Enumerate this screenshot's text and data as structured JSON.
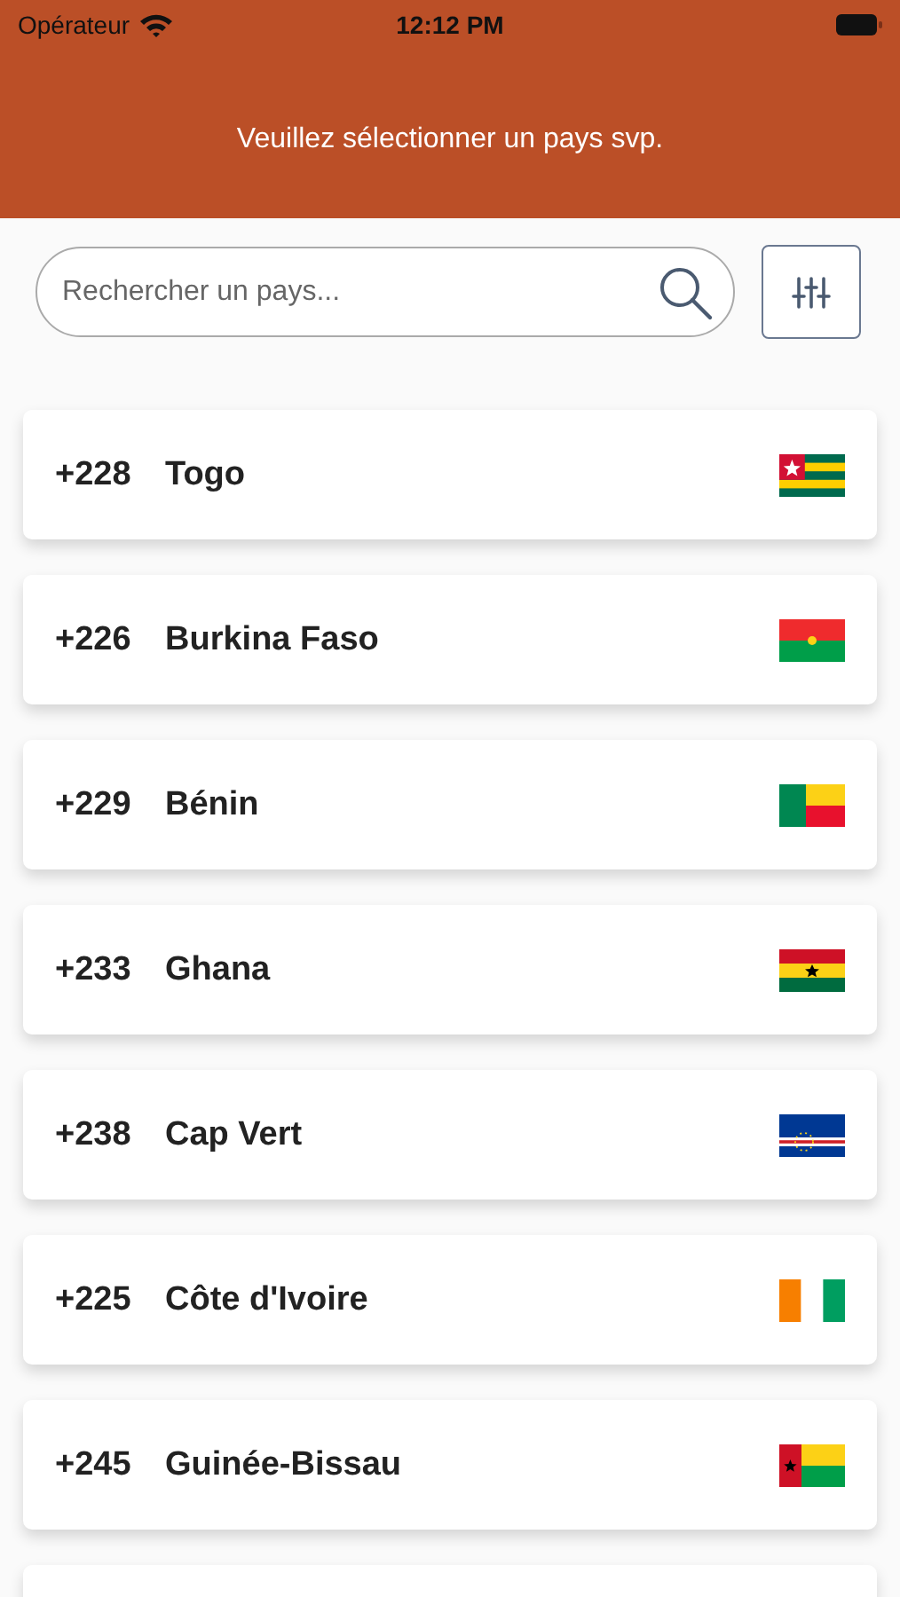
{
  "status_bar": {
    "carrier": "Opérateur",
    "time": "12:12 PM"
  },
  "header": {
    "title": "Veuillez sélectionner un pays svp."
  },
  "search": {
    "placeholder": "Rechercher un pays..."
  },
  "countries": [
    {
      "code": "+228",
      "name": "Togo",
      "kind": "togo"
    },
    {
      "code": "+226",
      "name": "Burkina Faso",
      "kind": "burkina"
    },
    {
      "code": "+229",
      "name": "Bénin",
      "kind": "benin"
    },
    {
      "code": "+233",
      "name": "Ghana",
      "kind": "ghana"
    },
    {
      "code": "+238",
      "name": "Cap Vert",
      "kind": "capvert"
    },
    {
      "code": "+225",
      "name": "Côte d'Ivoire",
      "kind": "civ"
    },
    {
      "code": "+245",
      "name": "Guinée-Bissau",
      "kind": "guineabissau"
    }
  ]
}
